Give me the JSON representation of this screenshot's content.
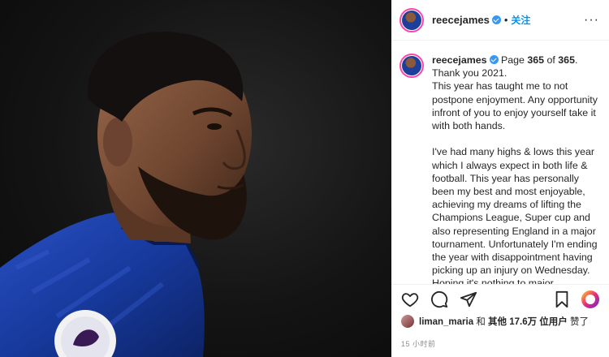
{
  "post": {
    "username": "reecejames",
    "follow_label": "关注",
    "dot": "•",
    "more": "···"
  },
  "caption": {
    "username": "reecejames",
    "lead_pre": "Page ",
    "num1": "365",
    "of": " of ",
    "num2": "365",
    "lead_post": ". Thank you 2021.",
    "text": "This year has taught me to not postpone enjoyment. Any opportunity infront of you to enjoy yourself take it with both hands.\n\nI've had many highs & lows this year which I always expect in both life & football. This year has personally been my best and most enjoyable, achieving my dreams of lifting the Champions League, Super cup and also representing England in a major tournament. Unfortunately I'm ending the year with disappointment having picking up an injury on Wednesday. Hoping it's nothing to major.\nI'll be working as hard as possible to get"
  },
  "likes": {
    "user": "liman_maria",
    "and": " 和 ",
    "others": "其他 17.6万 位用户",
    "liked": " 赞了"
  },
  "timestamp": "15 小时前"
}
